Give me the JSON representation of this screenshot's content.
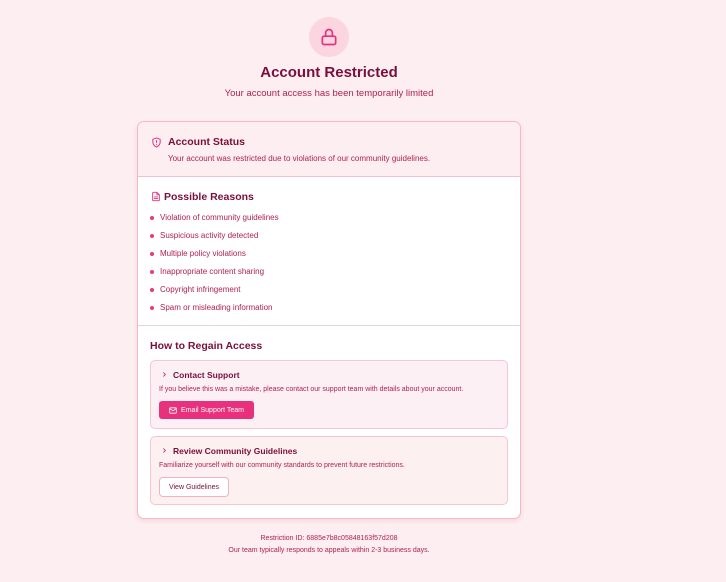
{
  "header": {
    "title": "Account Restricted",
    "subtitle": "Your account access has been temporarily limited",
    "icon": "lock-icon"
  },
  "status": {
    "title": "Account Status",
    "text": "Your account was restricted due to violations of our community guidelines.",
    "icon": "shield-icon"
  },
  "reasons": {
    "title": "Possible Reasons",
    "icon": "document-icon",
    "items": [
      "Violation of community guidelines",
      "Suspicious activity detected",
      "Multiple policy violations",
      "Inappropriate content sharing",
      "Copyright infringement",
      "Spam or misleading information"
    ]
  },
  "regain": {
    "title": "How to Regain Access",
    "contact": {
      "title": "Contact Support",
      "text": "If you believe this was a mistake, please contact our support team with details about your account.",
      "button": "Email Support Team"
    },
    "guidelines": {
      "title": "Review Community Guidelines",
      "text": "Familiarize yourself with our community standards to prevent future restrictions.",
      "button": "View Guidelines"
    }
  },
  "footer": {
    "restriction_id": "Restriction ID: 6885e7b8c05848163f57d208",
    "note": "Our team typically responds to appeals within 2-3 business days."
  },
  "colors": {
    "background": "#fdeef2",
    "accent": "#e8307d",
    "heading": "#7a0f3a",
    "text": "#b0214f"
  }
}
